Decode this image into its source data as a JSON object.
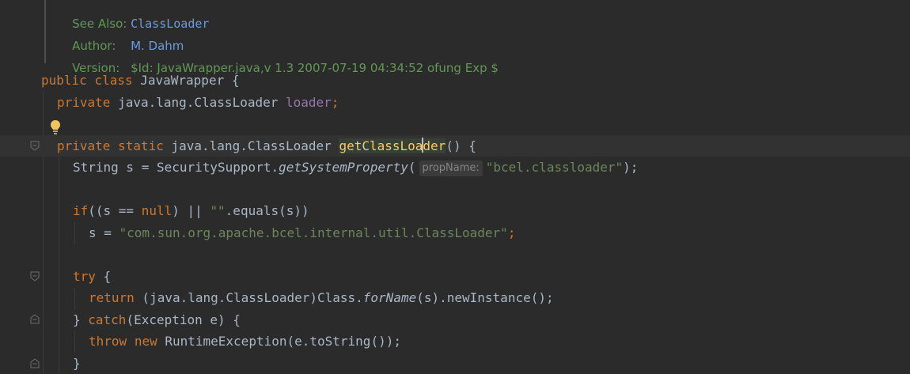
{
  "javadoc": {
    "see_also_label": "See Also:",
    "see_also_value": "ClassLoader",
    "author_label": "Author:",
    "author_value": "M. Dahm",
    "version_label": "Version:",
    "version_value": "$Id: JavaWrapper.java,v 1.3 2007-07-19 04:34:52 ofung Exp $"
  },
  "code": {
    "line1": {
      "kw1": "public",
      "kw2": "class",
      "rest": " JavaWrapper {"
    },
    "line2": {
      "kw": "private",
      "type": " java.lang.ClassLoader ",
      "field": "loader",
      "end": ";"
    },
    "line3": {
      "kw1": "private",
      "kw2": "static",
      "type": " java.lang.ClassLoader ",
      "method_a": "getClassLoa",
      "method_b": "der",
      "end": "() {"
    },
    "line4": {
      "pre": "String s = SecuritySupport.",
      "call": "getSystemProperty",
      "open": "(",
      "hint": "propName:",
      "arg": "\"bcel.classloader\"",
      "end": ");"
    },
    "line5": {
      "kw": "if",
      "a": "((s == ",
      "null": "null",
      "b": ") || ",
      "empty": "\"\"",
      "c": ".equals(s))"
    },
    "line6": {
      "pre": "s = ",
      "str": "\"com.sun.org.apache.bcel.internal.util.ClassLoader\"",
      "end": ";"
    },
    "line7": {
      "kw": "try",
      "end": " {"
    },
    "line8": {
      "kw": "return",
      "pre": " (java.lang.ClassLoader)Class.",
      "call": "forName",
      "end": "(s).newInstance();"
    },
    "line9": {
      "pre": "} ",
      "kw": "catch",
      "end": "(Exception e) {"
    },
    "line10": {
      "kw1": "throw",
      "kw2": "new",
      "end": " RuntimeException(e.toString());"
    },
    "line11": {
      "text": "}"
    }
  },
  "colors": {
    "background": "#2b2b2b",
    "keyword": "#cc7832",
    "string": "#6a8759",
    "field": "#9876aa",
    "method_declaration": "#ffc66d",
    "doc_text": "#629755",
    "doc_link": "#6a9be0",
    "default": "#a9b7c6"
  }
}
